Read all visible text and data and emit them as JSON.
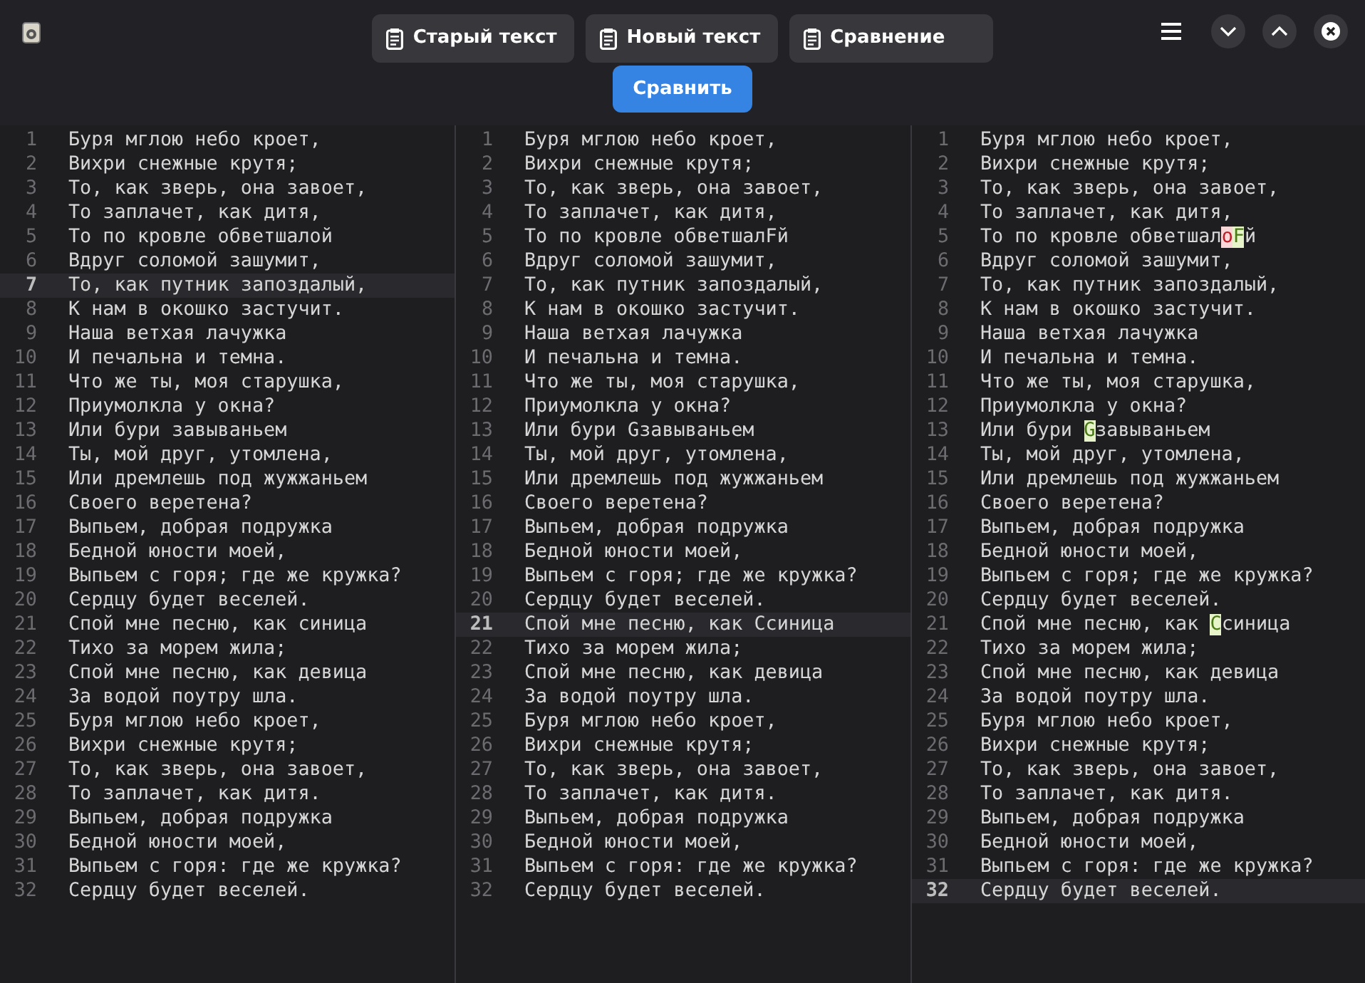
{
  "header": {
    "tabs": [
      {
        "label": "Старый текст",
        "selected": false
      },
      {
        "label": "Новый текст",
        "selected": false
      },
      {
        "label": "Сравнение",
        "selected": false
      }
    ],
    "compare_button": "Сравнить"
  },
  "panes": [
    {
      "lines": [
        {
          "n": "1",
          "text": "Буря мглою небо кроет,",
          "current": false
        },
        {
          "n": "2",
          "text": "Вихри снежные крутя;",
          "current": false
        },
        {
          "n": "3",
          "text": "То, как зверь, она завоет,",
          "current": false
        },
        {
          "n": "4",
          "text": "То заплачет, как дитя,",
          "current": false
        },
        {
          "n": "5",
          "text": "То по кровле обветшалой",
          "current": false
        },
        {
          "n": "6",
          "text": "Вдруг соломой зашумит,",
          "current": false
        },
        {
          "n": "7",
          "text": "То, как путник запоздалый,",
          "current": true
        },
        {
          "n": "8",
          "text": "К нам в окошко застучит.",
          "current": false
        },
        {
          "n": "9",
          "text": "Наша ветхая лачужка",
          "current": false
        },
        {
          "n": "10",
          "text": "И печальна и темна.",
          "current": false
        },
        {
          "n": "11",
          "text": "Что же ты, моя старушка,",
          "current": false
        },
        {
          "n": "12",
          "text": "Приумолкла у окна?",
          "current": false
        },
        {
          "n": "13",
          "text": "Или бури завываньем",
          "current": false
        },
        {
          "n": "14",
          "text": "Ты, мой друг, утомлена,",
          "current": false
        },
        {
          "n": "15",
          "text": "Или дремлешь под жужжаньем",
          "current": false
        },
        {
          "n": "16",
          "text": "Своего веретена?",
          "current": false
        },
        {
          "n": "17",
          "text": "Выпьем, добрая подружка",
          "current": false
        },
        {
          "n": "18",
          "text": "Бедной юности моей,",
          "current": false
        },
        {
          "n": "19",
          "text": "Выпьем с горя; где же кружка?",
          "current": false
        },
        {
          "n": "20",
          "text": "Сердцу будет веселей.",
          "current": false
        },
        {
          "n": "21",
          "text": "Спой мне песню, как синица",
          "current": false
        },
        {
          "n": "22",
          "text": "Тихо за морем жила;",
          "current": false
        },
        {
          "n": "23",
          "text": "Спой мне песню, как девица",
          "current": false
        },
        {
          "n": "24",
          "text": "За водой поутру шла.",
          "current": false
        },
        {
          "n": "25",
          "text": "Буря мглою небо кроет,",
          "current": false
        },
        {
          "n": "26",
          "text": "Вихри снежные крутя;",
          "current": false
        },
        {
          "n": "27",
          "text": "То, как зверь, она завоет,",
          "current": false
        },
        {
          "n": "28",
          "text": "То заплачет, как дитя.",
          "current": false
        },
        {
          "n": "29",
          "text": "Выпьем, добрая подружка",
          "current": false
        },
        {
          "n": "30",
          "text": "Бедной юности моей,",
          "current": false
        },
        {
          "n": "31",
          "text": "Выпьем с горя: где же кружка?",
          "current": false
        },
        {
          "n": "32",
          "text": "Сердцу будет веселей.",
          "current": false
        }
      ]
    },
    {
      "lines": [
        {
          "n": "1",
          "text": "Буря мглою небо кроет,",
          "current": false
        },
        {
          "n": "2",
          "text": "Вихри снежные крутя;",
          "current": false
        },
        {
          "n": "3",
          "text": "То, как зверь, она завоет,",
          "current": false
        },
        {
          "n": "4",
          "text": "То заплачет, как дитя,",
          "current": false
        },
        {
          "n": "5",
          "text": "То по кровле обветшалFй",
          "current": false
        },
        {
          "n": "6",
          "text": "Вдруг соломой зашумит,",
          "current": false
        },
        {
          "n": "7",
          "text": "То, как путник запоздалый,",
          "current": false
        },
        {
          "n": "8",
          "text": "К нам в окошко застучит.",
          "current": false
        },
        {
          "n": "9",
          "text": "Наша ветхая лачужка",
          "current": false
        },
        {
          "n": "10",
          "text": "И печальна и темна.",
          "current": false
        },
        {
          "n": "11",
          "text": "Что же ты, моя старушка,",
          "current": false
        },
        {
          "n": "12",
          "text": "Приумолкла у окна?",
          "current": false
        },
        {
          "n": "13",
          "text": "Или бури Gзавываньем",
          "current": false
        },
        {
          "n": "14",
          "text": "Ты, мой друг, утомлена,",
          "current": false
        },
        {
          "n": "15",
          "text": "Или дремлешь под жужжаньем",
          "current": false
        },
        {
          "n": "16",
          "text": "Своего веретена?",
          "current": false
        },
        {
          "n": "17",
          "text": "Выпьем, добрая подружка",
          "current": false
        },
        {
          "n": "18",
          "text": "Бедной юности моей,",
          "current": false
        },
        {
          "n": "19",
          "text": "Выпьем с горя; где же кружка?",
          "current": false
        },
        {
          "n": "20",
          "text": "Сердцу будет веселей.",
          "current": false
        },
        {
          "n": "21",
          "text": "Спой мне песню, как Ссиница",
          "current": true
        },
        {
          "n": "22",
          "text": "Тихо за морем жила;",
          "current": false
        },
        {
          "n": "23",
          "text": "Спой мне песню, как девица",
          "current": false
        },
        {
          "n": "24",
          "text": "За водой поутру шла.",
          "current": false
        },
        {
          "n": "25",
          "text": "Буря мглою небо кроет,",
          "current": false
        },
        {
          "n": "26",
          "text": "Вихри снежные крутя;",
          "current": false
        },
        {
          "n": "27",
          "text": "То, как зверь, она завоет,",
          "current": false
        },
        {
          "n": "28",
          "text": "То заплачет, как дитя.",
          "current": false
        },
        {
          "n": "29",
          "text": "Выпьем, добрая подружка",
          "current": false
        },
        {
          "n": "30",
          "text": "Бедной юности моей,",
          "current": false
        },
        {
          "n": "31",
          "text": "Выпьем с горя: где же кружка?",
          "current": false
        },
        {
          "n": "32",
          "text": "Сердцу будет веселей.",
          "current": false
        }
      ]
    },
    {
      "lines": [
        {
          "n": "1",
          "text": "Буря мглою небо кроет,",
          "current": false
        },
        {
          "n": "2",
          "text": "Вихри снежные крутя;",
          "current": false
        },
        {
          "n": "3",
          "text": "То, как зверь, она завоет,",
          "current": false
        },
        {
          "n": "4",
          "text": "То заплачет, как дитя,",
          "current": false
        },
        {
          "n": "5",
          "segments": [
            {
              "text": "То по кровле обветшал",
              "kind": "same"
            },
            {
              "text": "о",
              "kind": "deleted"
            },
            {
              "text": "F",
              "kind": "inserted"
            },
            {
              "text": "й",
              "kind": "same"
            }
          ],
          "current": false
        },
        {
          "n": "6",
          "text": "Вдруг соломой зашумит,",
          "current": false
        },
        {
          "n": "7",
          "text": "То, как путник запоздалый,",
          "current": false
        },
        {
          "n": "8",
          "text": "К нам в окошко застучит.",
          "current": false
        },
        {
          "n": "9",
          "text": "Наша ветхая лачужка",
          "current": false
        },
        {
          "n": "10",
          "text": "И печальна и темна.",
          "current": false
        },
        {
          "n": "11",
          "text": "Что же ты, моя старушка,",
          "current": false
        },
        {
          "n": "12",
          "text": "Приумолкла у окна?",
          "current": false
        },
        {
          "n": "13",
          "segments": [
            {
              "text": "Или бури ",
              "kind": "same"
            },
            {
              "text": "G",
              "kind": "inserted"
            },
            {
              "text": "завываньем",
              "kind": "same"
            }
          ],
          "current": false
        },
        {
          "n": "14",
          "text": "Ты, мой друг, утомлена,",
          "current": false
        },
        {
          "n": "15",
          "text": "Или дремлешь под жужжаньем",
          "current": false
        },
        {
          "n": "16",
          "text": "Своего веретена?",
          "current": false
        },
        {
          "n": "17",
          "text": "Выпьем, добрая подружка",
          "current": false
        },
        {
          "n": "18",
          "text": "Бедной юности моей,",
          "current": false
        },
        {
          "n": "19",
          "text": "Выпьем с горя; где же кружка?",
          "current": false
        },
        {
          "n": "20",
          "text": "Сердцу будет веселей.",
          "current": false
        },
        {
          "n": "21",
          "segments": [
            {
              "text": "Спой мне песню, как ",
              "kind": "same"
            },
            {
              "text": "С",
              "kind": "inserted"
            },
            {
              "text": "синица",
              "kind": "same"
            }
          ],
          "current": false
        },
        {
          "n": "22",
          "text": "Тихо за морем жила;",
          "current": false
        },
        {
          "n": "23",
          "text": "Спой мне песню, как девица",
          "current": false
        },
        {
          "n": "24",
          "text": "За водой поутру шла.",
          "current": false
        },
        {
          "n": "25",
          "text": "Буря мглою небо кроет,",
          "current": false
        },
        {
          "n": "26",
          "text": "Вихри снежные крутя;",
          "current": false
        },
        {
          "n": "27",
          "text": "То, как зверь, она завоет,",
          "current": false
        },
        {
          "n": "28",
          "text": "То заплачет, как дитя.",
          "current": false
        },
        {
          "n": "29",
          "text": "Выпьем, добрая подружка",
          "current": false
        },
        {
          "n": "30",
          "text": "Бедной юности моей,",
          "current": false
        },
        {
          "n": "31",
          "text": "Выпьем с горя: где же кружка?",
          "current": false
        },
        {
          "n": "32",
          "text": "Сердцу будет веселей.",
          "current": true
        }
      ]
    }
  ]
}
